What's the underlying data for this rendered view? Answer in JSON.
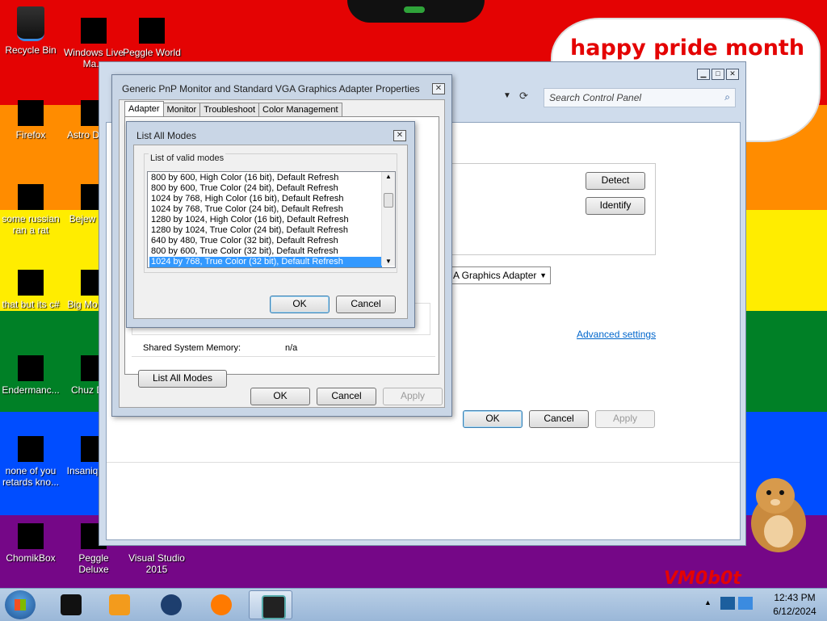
{
  "desktop": {
    "bubble_text": "happy pride month",
    "watermark": "VM0b0t",
    "icons": [
      {
        "label": "Recycle Bin"
      },
      {
        "label": "Windows Live Ma..."
      },
      {
        "label": "Peggle World"
      },
      {
        "label": "Firefox"
      },
      {
        "label": "Astro Delu..."
      },
      {
        "label": "some russian ran a rat"
      },
      {
        "label": "Bejew Delu"
      },
      {
        "label": "that but its c#"
      },
      {
        "label": "Big Mo Delu"
      },
      {
        "label": "Endermanc..."
      },
      {
        "label": "Chuz Delu"
      },
      {
        "label": "none of you retards kno..."
      },
      {
        "label": "Insaniq Delu"
      },
      {
        "label": "ChomikBox"
      },
      {
        "label": "Peggle Deluxe"
      },
      {
        "label": "Visual Studio 2015"
      }
    ]
  },
  "control_panel": {
    "search_placeholder": "Search Control Panel",
    "detect_label": "Detect",
    "identify_label": "Identify",
    "adapter_select": "A Graphics Adapter",
    "advanced_link": "Advanced settings",
    "ok_label": "OK",
    "cancel_label": "Cancel",
    "apply_label": "Apply"
  },
  "properties_dialog": {
    "title": "Generic PnP Monitor and Standard VGA Graphics Adapter Properties",
    "tabs": [
      "Adapter",
      "Monitor",
      "Troubleshoot",
      "Color Management"
    ],
    "shared_memory_label": "Shared System Memory:",
    "shared_memory_value": "n/a",
    "list_all_modes_label": "List All Modes",
    "ok_label": "OK",
    "cancel_label": "Cancel",
    "apply_label": "Apply"
  },
  "list_modes_dialog": {
    "title": "List All Modes",
    "group_label": "List of valid modes",
    "modes": [
      "800 by 600, High Color (16 bit), Default Refresh",
      "800 by 600, True Color (24 bit), Default Refresh",
      "1024 by 768, High Color (16 bit), Default Refresh",
      "1024 by 768, True Color (24 bit), Default Refresh",
      "1280 by 1024, High Color (16 bit), Default Refresh",
      "1280 by 1024, True Color (24 bit), Default Refresh",
      "640 by 480, True Color (32 bit), Default Refresh",
      "800 by 600, True Color (32 bit), Default Refresh",
      "1024 by 768, True Color (32 bit), Default Refresh"
    ],
    "selected_mode_index": 8,
    "ok_label": "OK",
    "cancel_label": "Cancel"
  },
  "taskbar": {
    "clock_time": "12:43 PM",
    "clock_date": "6/12/2024"
  }
}
